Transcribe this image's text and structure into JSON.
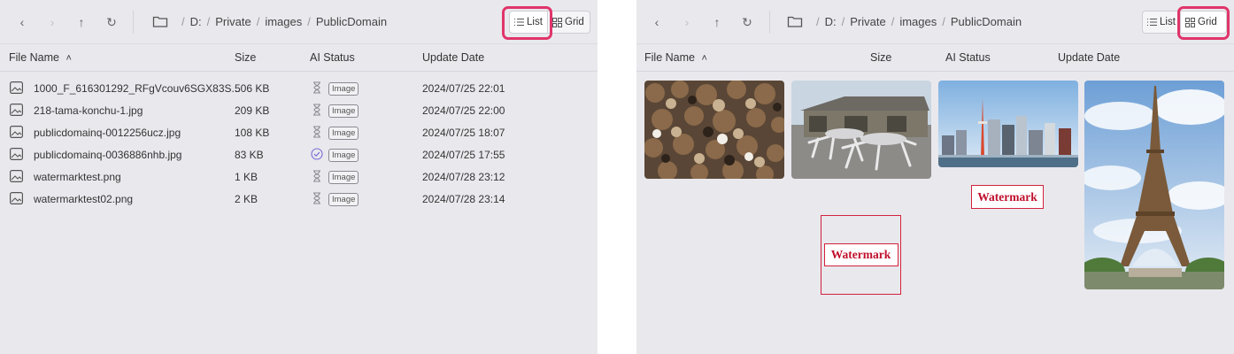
{
  "breadcrumb": {
    "drive": "D:",
    "folder1": "Private",
    "folder2": "images",
    "folder3": "PublicDomain",
    "separator": "/"
  },
  "view_toggle": {
    "list_label": "List",
    "grid_label": "Grid"
  },
  "columns": {
    "name": "File Name",
    "size": "Size",
    "status": "AI Status",
    "date": "Update Date"
  },
  "files": [
    {
      "name": "1000_F_616301292_RFgVcouv6SGX83S...",
      "size": "506 KB",
      "status_icon": "hourglass-icon",
      "badge": "Image",
      "date": "2024/07/25 22:01"
    },
    {
      "name": "218-tama-konchu-1.jpg",
      "size": "209 KB",
      "status_icon": "hourglass-icon",
      "badge": "Image",
      "date": "2024/07/25 22:00"
    },
    {
      "name": "publicdomainq-0012256ucz.jpg",
      "size": "108 KB",
      "status_icon": "hourglass-icon",
      "badge": "Image",
      "date": "2024/07/25 18:07"
    },
    {
      "name": "publicdomainq-0036886nhb.jpg",
      "size": "83 KB",
      "status_icon": "check-circle-icon",
      "badge": "Image",
      "date": "2024/07/25 17:55"
    },
    {
      "name": "watermarktest.png",
      "size": "1 KB",
      "status_icon": "hourglass-icon",
      "badge": "Image",
      "date": "2024/07/28 23:12"
    },
    {
      "name": "watermarktest02.png",
      "size": "2 KB",
      "status_icon": "hourglass-icon",
      "badge": "Image",
      "date": "2024/07/28 23:14"
    }
  ],
  "watermark_text": "Watermark",
  "colors": {
    "panel_bg": "#e9e8ed",
    "highlight": "#e0356a",
    "check": "#7a6fd6",
    "watermark": "#c0102c"
  }
}
